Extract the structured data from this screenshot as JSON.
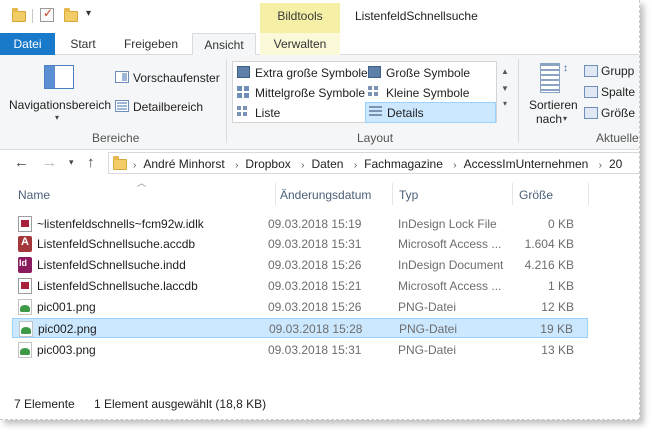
{
  "titlebar": {
    "contextual_tab": "Bildtools",
    "window_title": "ListenfeldSchnellsuche"
  },
  "tabs": {
    "datei": "Datei",
    "start": "Start",
    "freigeben": "Freigeben",
    "ansicht": "Ansicht",
    "verwalten": "Verwalten"
  },
  "ribbon": {
    "bereiche": {
      "navigationsbereich": "Navigationsbereich",
      "vorschaufenster": "Vorschaufenster",
      "detailbereich": "Detailbereich",
      "label": "Bereiche"
    },
    "layout": {
      "extra_gross": "Extra große Symbole",
      "gross": "Große Symbole",
      "mittelgross": "Mittelgroße Symbole",
      "klein": "Kleine Symbole",
      "liste": "Liste",
      "details": "Details",
      "label": "Layout"
    },
    "aktuelle_ansicht": {
      "sortieren": "Sortieren",
      "nach": "nach",
      "gruppieren": "Grupp",
      "spalten": "Spalte",
      "groesse": "Größe",
      "label": "Aktuelle"
    }
  },
  "address": {
    "crumbs": [
      "André Minhorst",
      "Dropbox",
      "Daten",
      "Fachmagazine",
      "AccessImUnternehmen",
      "20"
    ]
  },
  "columns": {
    "name": "Name",
    "date": "Änderungsdatum",
    "type": "Typ",
    "size": "Größe"
  },
  "files": [
    {
      "name": "~listenfeldschnells~fcm92w.idlk",
      "date": "09.03.2018 15:19",
      "type": "InDesign Lock File",
      "size": "0 KB",
      "icon": "lock-file-icon"
    },
    {
      "name": "ListenfeldSchnellsuche.accdb",
      "date": "09.03.2018 15:31",
      "type": "Microsoft Access ...",
      "size": "1.604 KB",
      "icon": "access-icon"
    },
    {
      "name": "ListenfeldSchnellsuche.indd",
      "date": "09.03.2018 15:26",
      "type": "InDesign Document",
      "size": "4.216 KB",
      "icon": "indesign-icon"
    },
    {
      "name": "ListenfeldSchnellsuche.laccdb",
      "date": "09.03.2018 15:21",
      "type": "Microsoft Access ...",
      "size": "1 KB",
      "icon": "access-lock-icon"
    },
    {
      "name": "pic001.png",
      "date": "09.03.2018 15:26",
      "type": "PNG-Datei",
      "size": "12 KB",
      "icon": "png-icon"
    },
    {
      "name": "pic002.png",
      "date": "09.03.2018 15:28",
      "type": "PNG-Datei",
      "size": "19 KB",
      "icon": "png-icon"
    },
    {
      "name": "pic003.png",
      "date": "09.03.2018 15:31",
      "type": "PNG-Datei",
      "size": "13 KB",
      "icon": "png-icon"
    }
  ],
  "status": {
    "count": "7 Elemente",
    "selection": "1 Element ausgewählt (18,8 KB)"
  },
  "colors": {
    "accent": "#1979ca",
    "selection": "#cce8ff",
    "contextual": "#f5f0a6"
  }
}
